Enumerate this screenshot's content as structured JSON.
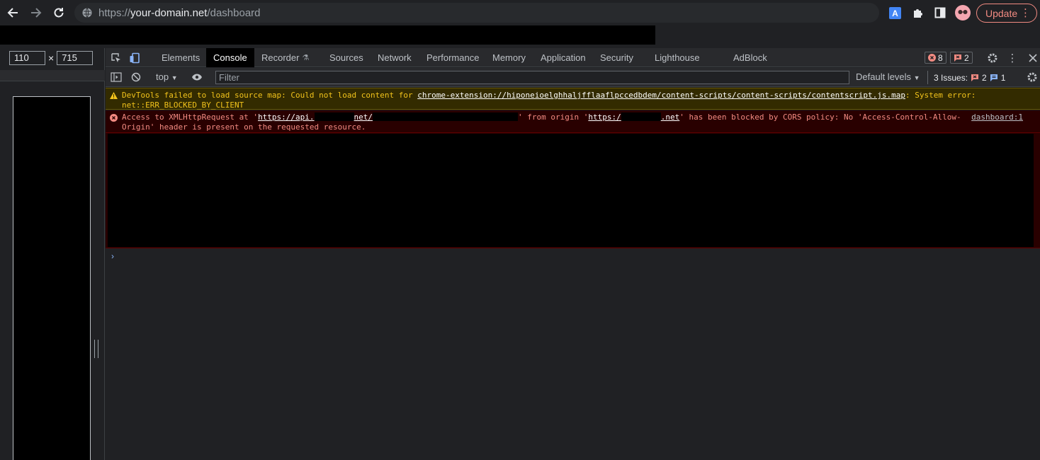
{
  "browser": {
    "url_scheme": "https://",
    "url_host": "your-domain.net",
    "url_path": "/dashboard",
    "update_label": "Update"
  },
  "device": {
    "width": "110",
    "height": "715",
    "times": "×"
  },
  "devtools": {
    "tabs": [
      {
        "label": "Elements"
      },
      {
        "label": "Console"
      },
      {
        "label": "Recorder"
      },
      {
        "label": "Sources"
      },
      {
        "label": "Network"
      },
      {
        "label": "Performance"
      },
      {
        "label": "Memory"
      },
      {
        "label": "Application"
      },
      {
        "label": "Security"
      },
      {
        "label": "Lighthouse"
      },
      {
        "label": "AdBlock"
      }
    ],
    "active_tab": "Console",
    "error_count": "8",
    "issue_count": "2",
    "context": "top",
    "filter_placeholder": "Filter",
    "levels": "Default levels",
    "issues_label": "3 Issues:",
    "issues_errors": "2",
    "issues_info": "1"
  },
  "console": {
    "warning": {
      "prefix": "DevTools failed to load source map: Could not load content for ",
      "link": "chrome-extension://hiponeioelghhaljfflaaflpccedbdem/content-scripts/content-scripts/contentscript.js.map",
      "suffix": ": System error: net::ERR_BLOCKED_BY_CLIENT"
    },
    "error": {
      "p1": "Access to XMLHttpRequest at '",
      "link1a": "https://api.",
      "link1b": "net/",
      "p2": "' from origin '",
      "link2a": "https:/",
      "link2b": ".net",
      "p3": "' has been blocked by CORS policy: No 'Access-Control-Allow-Origin' header is present on the requested resource.",
      "source": "dashboard:1"
    },
    "prompt": "›"
  },
  "colors": {
    "accent": "#8ab4f8",
    "error": "#f28b82",
    "warning": "#f2c31b"
  }
}
